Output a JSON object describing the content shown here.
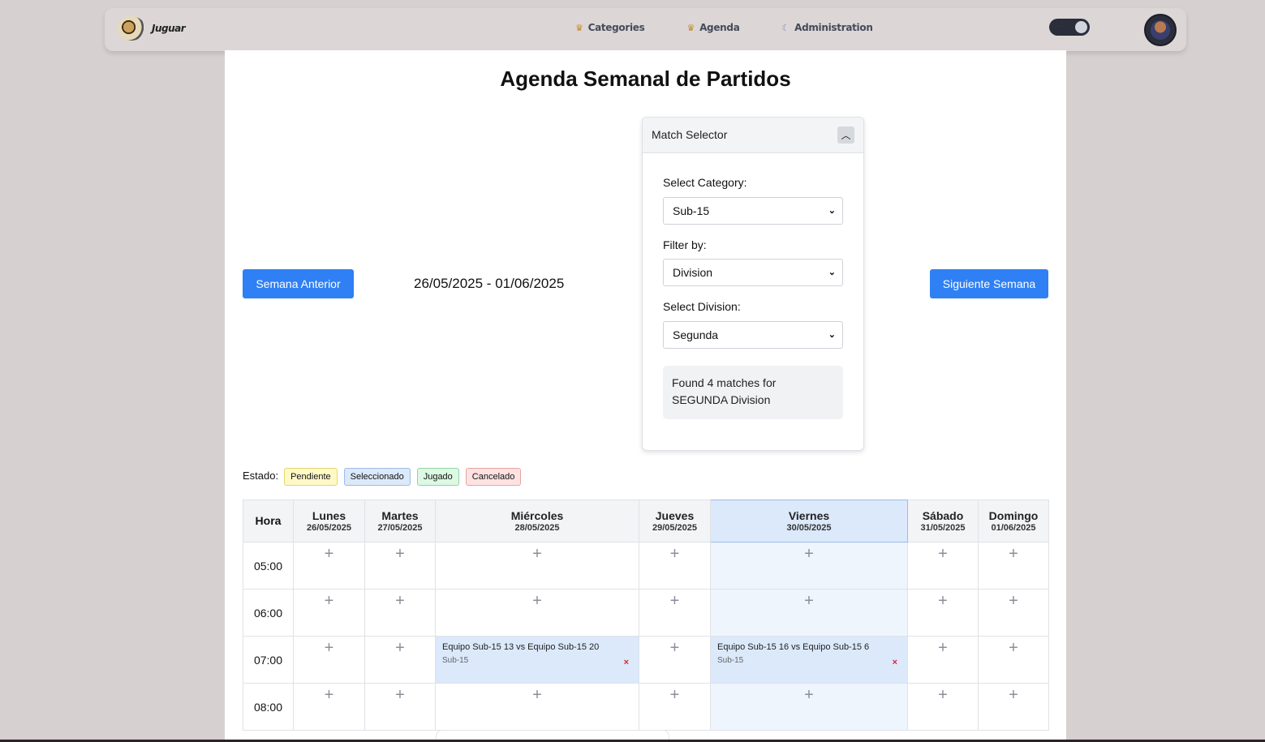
{
  "nav": {
    "brand": "Juguar",
    "links": [
      {
        "label": "Categories",
        "icon": "trophy-icon"
      },
      {
        "label": "Agenda",
        "icon": "trophy-icon"
      },
      {
        "label": "Administration",
        "icon": "moon-icon"
      }
    ]
  },
  "page": {
    "title": "Agenda Semanal de Partidos",
    "prev_label": "Semana Anterior",
    "next_label": "Siguiente Semana",
    "week_range": "26/05/2025 - 01/06/2025"
  },
  "selector": {
    "title": "Match Selector",
    "category_label": "Select Category:",
    "category_value": "Sub-15",
    "filter_label": "Filter by:",
    "filter_value": "Division",
    "division_label": "Select Division:",
    "division_value": "Segunda",
    "found_text": "Found 4 matches for SEGUNDA Division"
  },
  "legend": {
    "label": "Estado:",
    "pendiente": "Pendiente",
    "seleccionado": "Seleccionado",
    "jugado": "Jugado",
    "cancelado": "Cancelado"
  },
  "calendar": {
    "hora_label": "Hora",
    "days": [
      {
        "name": "Lunes",
        "date": "26/05/2025"
      },
      {
        "name": "Martes",
        "date": "27/05/2025"
      },
      {
        "name": "Miércoles",
        "date": "28/05/2025"
      },
      {
        "name": "Jueves",
        "date": "29/05/2025"
      },
      {
        "name": "Viernes",
        "date": "30/05/2025"
      },
      {
        "name": "Sábado",
        "date": "31/05/2025"
      },
      {
        "name": "Domingo",
        "date": "01/06/2025"
      }
    ],
    "hours": [
      "05:00",
      "06:00",
      "07:00",
      "08:00"
    ],
    "add_symbol": "+",
    "matches": [
      {
        "title": "Equipo Sub-15 13 vs Equipo Sub-15 20",
        "category": "Sub-15",
        "delete": "×"
      },
      {
        "title": "Equipo Sub-15 16 vs Equipo Sub-15 6",
        "category": "Sub-15",
        "delete": "×"
      }
    ]
  },
  "colors": {
    "primary": "#2f80f4",
    "today_header": "#dbe9fb",
    "today_cell": "#eef5fd",
    "delete": "#e0222a"
  }
}
